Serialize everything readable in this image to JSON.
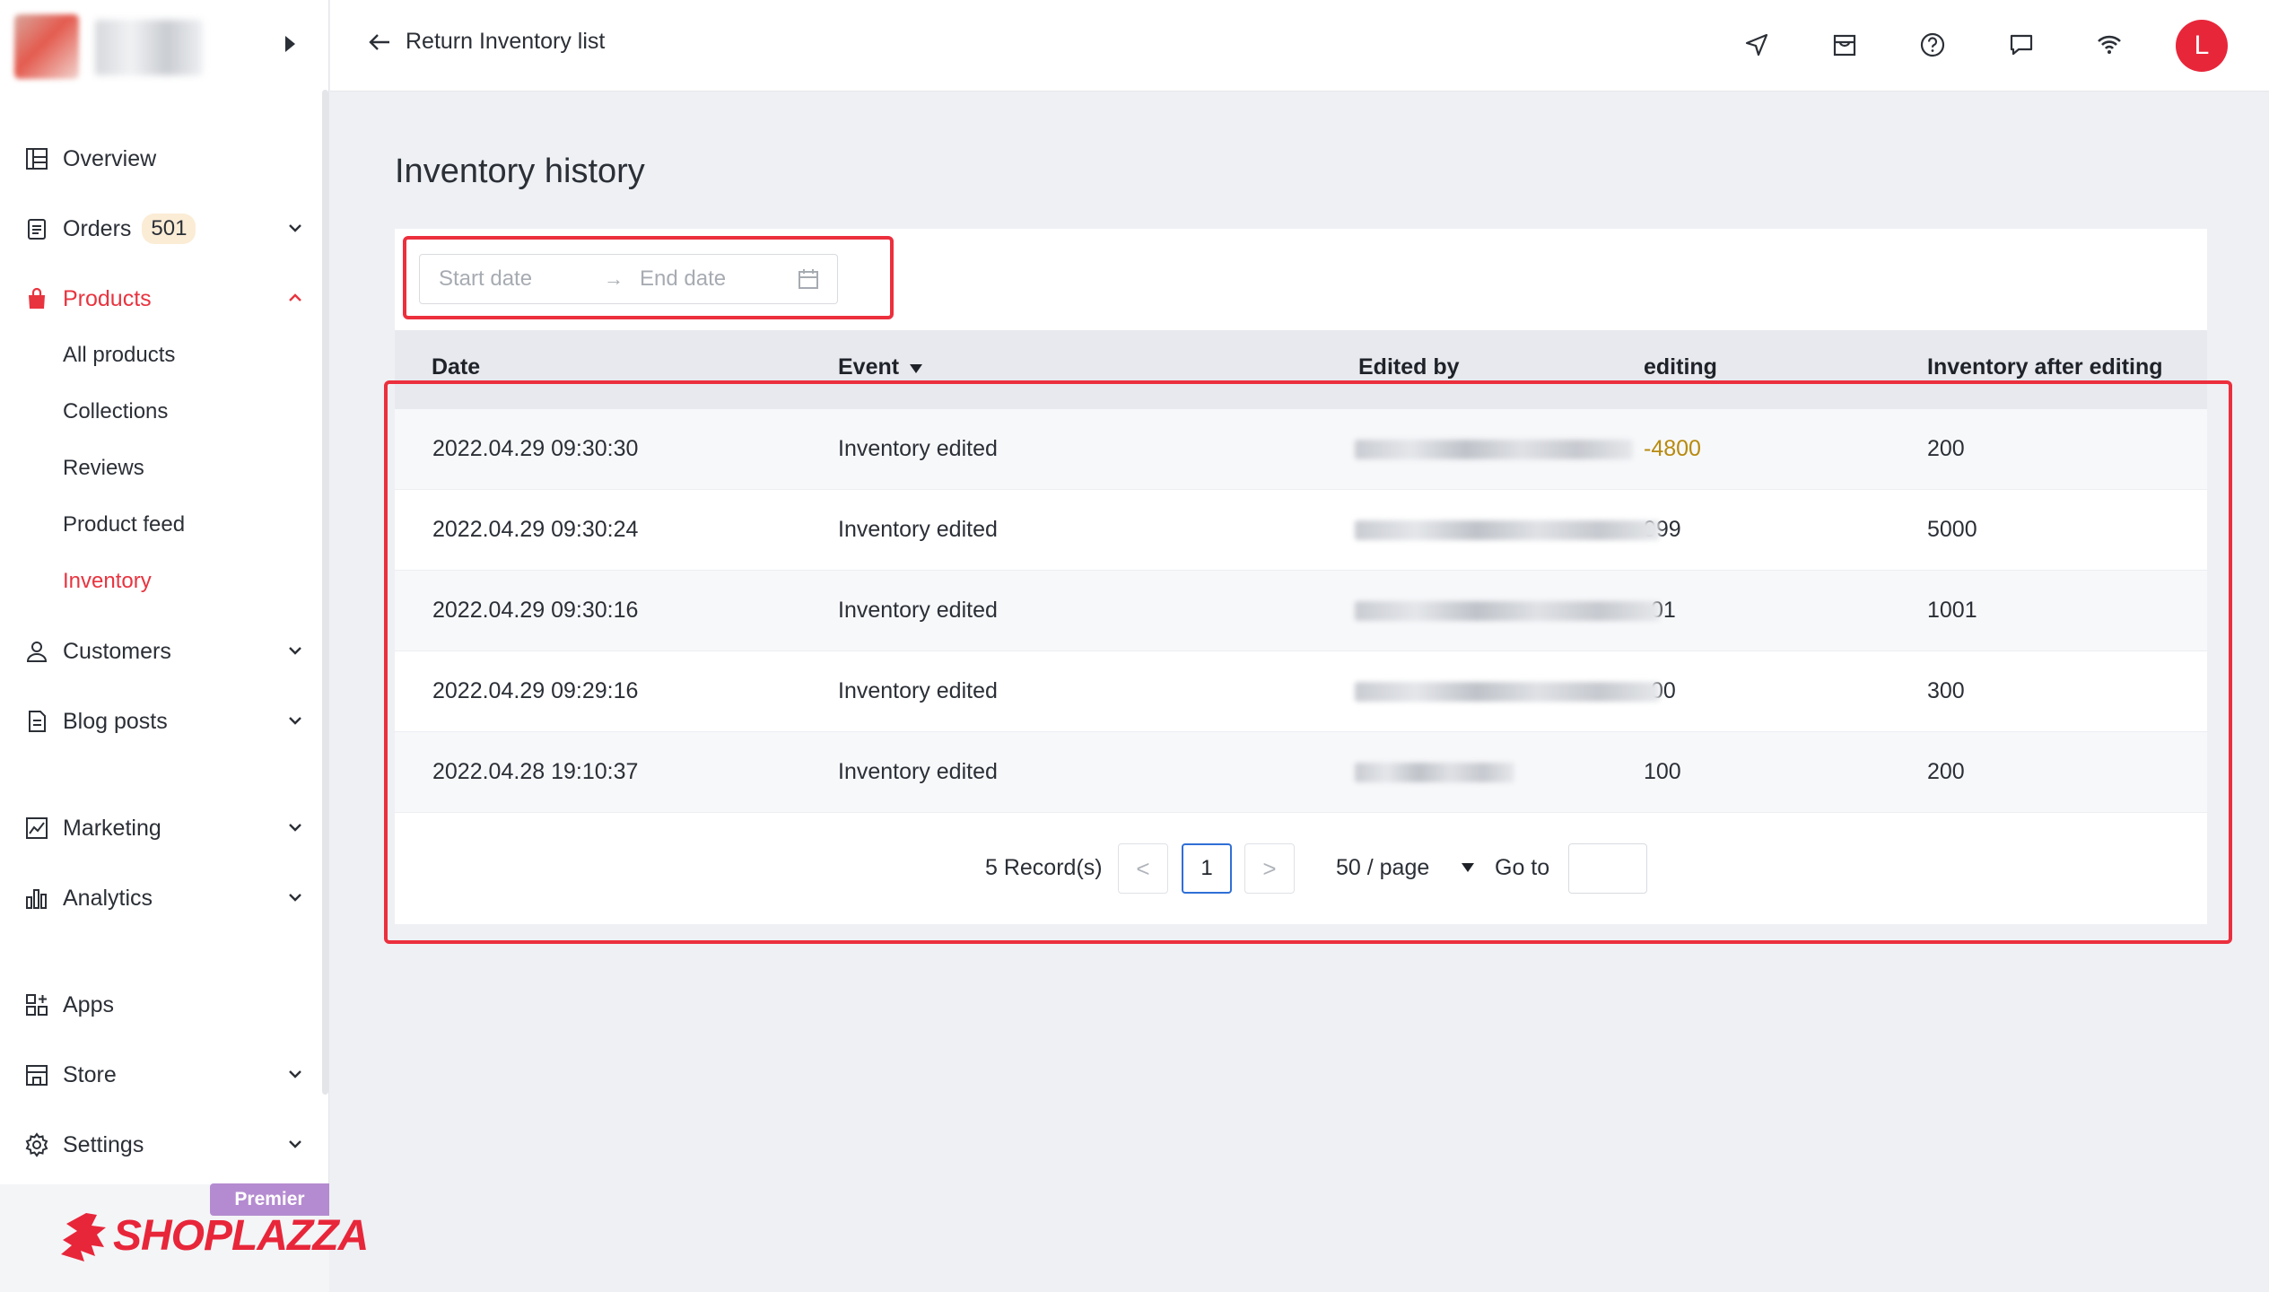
{
  "sidebar": {
    "items": [
      {
        "label": "Overview",
        "icon": "layout-icon"
      },
      {
        "label": "Orders",
        "badge": "501",
        "icon": "clipboard-icon"
      },
      {
        "label": "Products",
        "icon": "bag-icon",
        "active": true
      },
      {
        "label": "Customers",
        "icon": "user-icon"
      },
      {
        "label": "Blog posts",
        "icon": "document-icon"
      },
      {
        "label": "Marketing",
        "icon": "marketing-icon"
      },
      {
        "label": "Analytics",
        "icon": "bar-chart-icon"
      },
      {
        "label": "Apps",
        "icon": "apps-icon"
      },
      {
        "label": "Store",
        "icon": "store-icon"
      },
      {
        "label": "Settings",
        "icon": "gear-icon"
      }
    ],
    "sub_items": [
      "All products",
      "Collections",
      "Reviews",
      "Product feed",
      "Inventory"
    ],
    "plan_badge": "Premier",
    "logo_text": "SHOPLAZZA"
  },
  "header": {
    "back_label": "Return Inventory list",
    "avatar_letter": "L",
    "icons": [
      "send-icon",
      "store-front-icon",
      "help-icon",
      "chat-icon",
      "wifi-icon"
    ]
  },
  "page": {
    "title": "Inventory history"
  },
  "filter": {
    "start_placeholder": "Start date",
    "arrow": "→",
    "end_placeholder": "End date"
  },
  "table": {
    "columns": [
      "Date",
      "Event",
      "Edited by",
      "editing",
      "Inventory after editing"
    ],
    "rows": [
      {
        "date": "2022.04.29 09:30:30",
        "event": "Inventory edited",
        "editing": "-4800",
        "after": "200"
      },
      {
        "date": "2022.04.29 09:30:24",
        "event": "Inventory edited",
        "editing": "999",
        "after": "5000"
      },
      {
        "date": "2022.04.29 09:30:16",
        "event": "Inventory edited",
        "editing": "01",
        "after": "1001"
      },
      {
        "date": "2022.04.29 09:29:16",
        "event": "Inventory edited",
        "editing": "00",
        "after": "300"
      },
      {
        "date": "2022.04.28 19:10:37",
        "event": "Inventory edited",
        "editing": "100",
        "after": "200"
      }
    ]
  },
  "pagination": {
    "records": "5 Record(s)",
    "prev": "<",
    "current": "1",
    "next": ">",
    "page_size": "50 / page",
    "goto_label": "Go to"
  },
  "colors": {
    "accent": "#e8343f",
    "highlight_box": "#ec2f3d",
    "negative_value": "#b78a0f",
    "current_page_border": "#2f6fd6"
  }
}
